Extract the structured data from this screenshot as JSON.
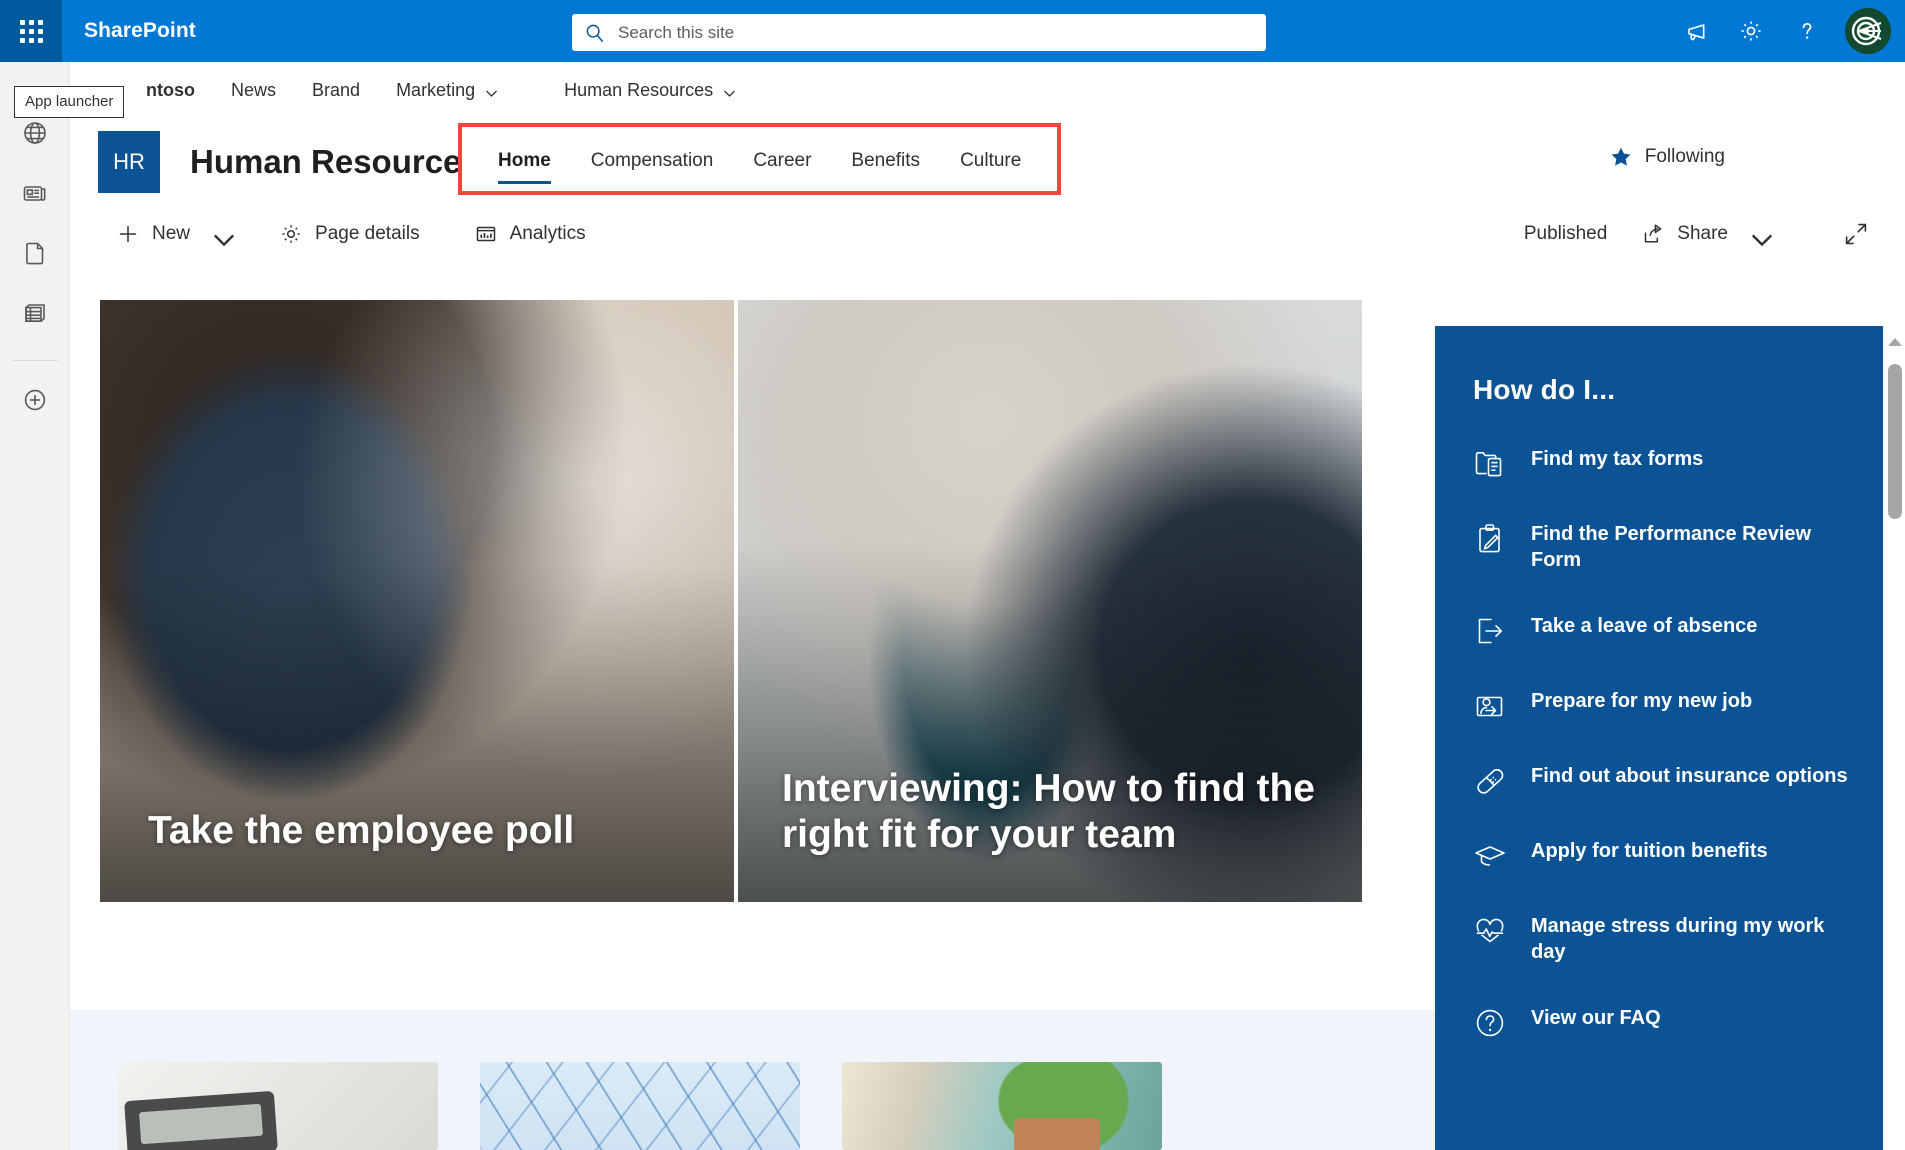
{
  "suite": {
    "app_launcher_tooltip": "App launcher",
    "title": "SharePoint",
    "search_placeholder": "Search this site",
    "search_value": "",
    "actions": [
      {
        "name": "megaphone-icon",
        "label": "Announcements"
      },
      {
        "name": "gear-icon",
        "label": "Settings"
      },
      {
        "name": "help-icon",
        "label": "Help"
      }
    ],
    "avatar_label": "Contoso"
  },
  "hub_nav": {
    "items": [
      {
        "label": "ntoso",
        "has_chevron": false,
        "brand": true
      },
      {
        "label": "News",
        "has_chevron": false,
        "brand": false
      },
      {
        "label": "Brand",
        "has_chevron": false,
        "brand": false
      },
      {
        "label": "Marketing",
        "has_chevron": true,
        "brand": false
      },
      {
        "label": "Human Resources",
        "has_chevron": true,
        "brand": false
      }
    ]
  },
  "rail": {
    "items": [
      {
        "name": "globe-icon",
        "label": "Site"
      },
      {
        "name": "news-icon",
        "label": "News"
      },
      {
        "name": "document-icon",
        "label": "Documents"
      },
      {
        "name": "list-icon",
        "label": "Lists"
      },
      {
        "name": "add-icon",
        "label": "Create"
      }
    ]
  },
  "site": {
    "logo_text": "HR",
    "title": "Human Resources",
    "following_label": "Following",
    "tabs": [
      {
        "label": "Home",
        "active": true
      },
      {
        "label": "Compensation",
        "active": false
      },
      {
        "label": "Career",
        "active": false
      },
      {
        "label": "Benefits",
        "active": false
      },
      {
        "label": "Culture",
        "active": false
      }
    ]
  },
  "command_bar": {
    "new_label": "New",
    "page_details_label": "Page details",
    "analytics_label": "Analytics",
    "status_label": "Published",
    "share_label": "Share"
  },
  "hero": {
    "tiles": [
      {
        "caption": "Take the employee poll"
      },
      {
        "caption": "Interviewing: How to find the right fit for your team"
      }
    ]
  },
  "cards": [
    {
      "name": "card-calculator"
    },
    {
      "name": "card-abstract-lines"
    },
    {
      "name": "card-heart-plant"
    }
  ],
  "how_do_i": {
    "title": "How do I...",
    "items": [
      {
        "label": "Find my tax forms",
        "icon": "folder-form-icon"
      },
      {
        "label": "Find the Performance Review Form",
        "icon": "clipboard-edit-icon"
      },
      {
        "label": "Take a leave of absence",
        "icon": "sign-out-icon"
      },
      {
        "label": "Prepare for my new job",
        "icon": "onboarding-icon"
      },
      {
        "label": "Find out about insurance options",
        "icon": "bandage-icon"
      },
      {
        "label": "Apply for tuition benefits",
        "icon": "graduation-cap-icon"
      },
      {
        "label": "Manage stress during my work day",
        "icon": "heart-pulse-icon"
      },
      {
        "label": "View our FAQ",
        "icon": "question-icon"
      }
    ]
  },
  "colors": {
    "suite_bar": "#0078d4",
    "waffle": "#005a9e",
    "panel_blue": "#0b5394",
    "accent_red": "#f4453c",
    "rail_bg": "#f3f2f1",
    "lower_bg": "#eff5fa"
  }
}
